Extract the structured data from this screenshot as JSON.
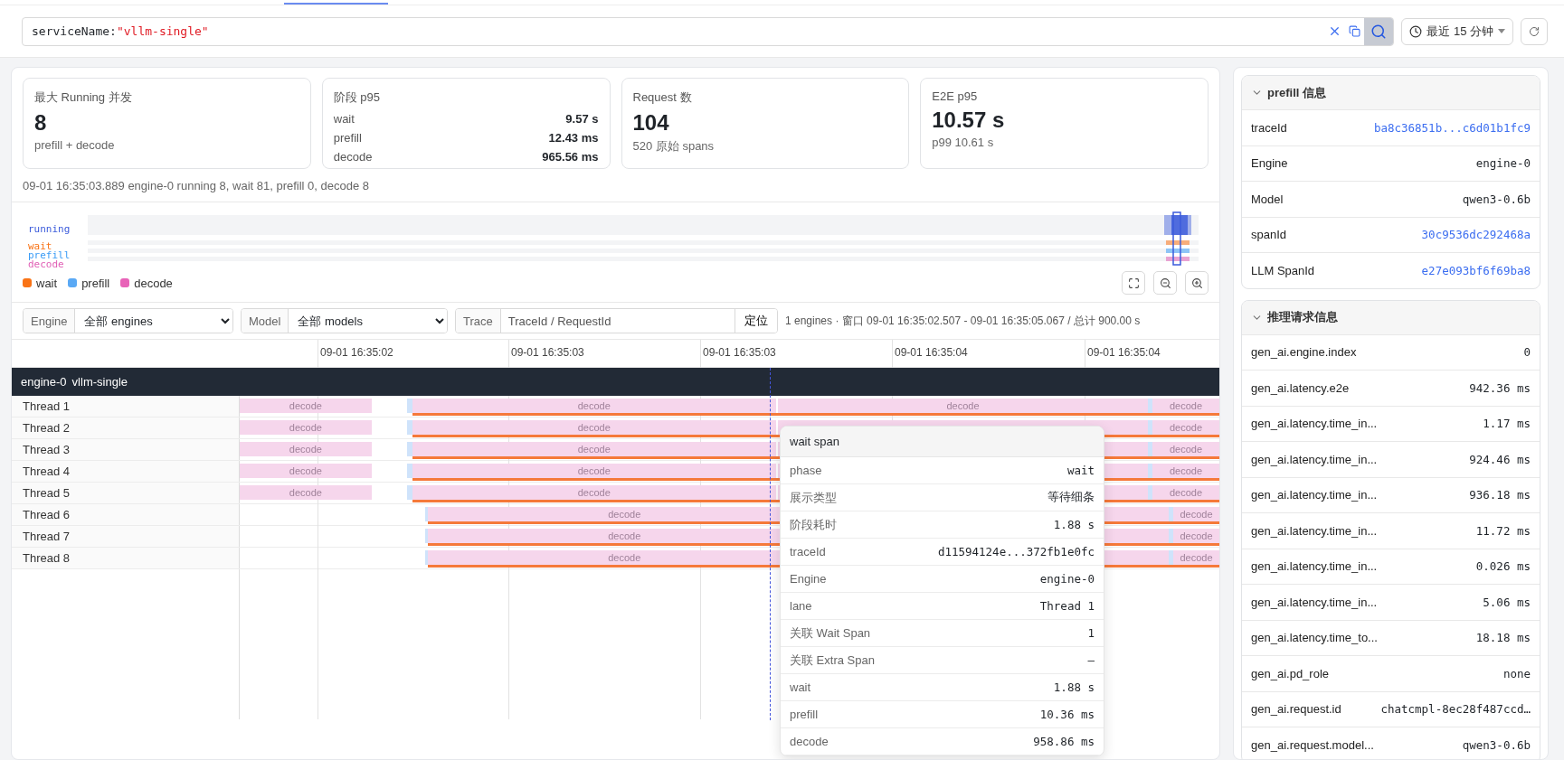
{
  "search": {
    "key": "serviceName:",
    "value": "\"vllm-single\""
  },
  "time_range": {
    "label": "最近 15 分钟"
  },
  "cards": [
    {
      "kind": "stat",
      "title": "最大 Running 并发",
      "value": "8",
      "sub": "prefill + decode"
    },
    {
      "kind": "table",
      "title": "阶段 p95",
      "rows": [
        {
          "label": "wait",
          "value": "9.57 s"
        },
        {
          "label": "prefill",
          "value": "12.43 ms"
        },
        {
          "label": "decode",
          "value": "965.56 ms"
        }
      ]
    },
    {
      "kind": "stat",
      "title": "Request 数",
      "value": "104",
      "sub": "520 原始 spans"
    },
    {
      "kind": "stat",
      "title": "E2E p95",
      "value": "10.57 s",
      "sub": "p99 10.61 s"
    }
  ],
  "status_line": "09-01 16:35:03.889 engine-0 running 8, wait 81, prefill 0, decode 8",
  "minimap": {
    "rows": [
      {
        "label": "running",
        "color": "#3b5bdb"
      },
      {
        "label": "wait",
        "color": "#f97316"
      },
      {
        "label": "prefill",
        "color": "#3b9cf6"
      },
      {
        "label": "decode",
        "color": "#e05fb5"
      }
    ]
  },
  "legend": [
    {
      "label": "wait",
      "color": "#f97316"
    },
    {
      "label": "prefill",
      "color": "#5aa9f5"
    },
    {
      "label": "decode",
      "color": "#e863b8"
    }
  ],
  "filters": {
    "engine": {
      "label": "Engine",
      "value": "全部 engines"
    },
    "model": {
      "label": "Model",
      "value": "全部 models"
    },
    "trace": {
      "label": "Trace",
      "placeholder": "TraceId / RequestId",
      "button": "定位"
    },
    "summary": "1 engines · 窗口 09-01 16:35:02.507 - 09-01 16:35:05.067 / 总计 900.00 s"
  },
  "axis_ticks": [
    "09-01 16:35:02",
    "09-01 16:35:03",
    "09-01 16:35:03",
    "09-01 16:35:04",
    "09-01 16:35:04"
  ],
  "engine_group": {
    "name": "engine-0",
    "service": "vllm-single"
  },
  "threads": [
    {
      "name": "Thread 1",
      "spans": [
        "decode",
        "decode",
        "decode",
        "decode"
      ]
    },
    {
      "name": "Thread 2",
      "spans": [
        "decode",
        "decode",
        "decode"
      ]
    },
    {
      "name": "Thread 3",
      "spans": [
        "decode",
        "decode",
        "decode"
      ]
    },
    {
      "name": "Thread 4",
      "spans": [
        "decode",
        "decode",
        "decode"
      ]
    },
    {
      "name": "Thread 5",
      "spans": [
        "decode",
        "decode",
        "decode"
      ]
    },
    {
      "name": "Thread 6",
      "spans": [
        "decode",
        "decode"
      ]
    },
    {
      "name": "Thread 7",
      "spans": [
        "decode",
        "decode"
      ]
    },
    {
      "name": "Thread 8",
      "spans": [
        "decode",
        "decode"
      ]
    }
  ],
  "tooltip": {
    "title": "wait span",
    "rows": [
      {
        "label": "phase",
        "value": "wait"
      },
      {
        "label": "展示类型",
        "value": "等待细条"
      },
      {
        "label": "阶段耗时",
        "value": "1.88 s"
      },
      {
        "label": "traceId",
        "value": "d11594124e...372fb1e0fc"
      },
      {
        "label": "Engine",
        "value": "engine-0"
      },
      {
        "label": "lane",
        "value": "Thread 1"
      },
      {
        "label": "关联 Wait Span",
        "value": "1"
      },
      {
        "label": "关联 Extra Span",
        "value": "–"
      },
      {
        "label": "wait",
        "value": "1.88 s"
      },
      {
        "label": "prefill",
        "value": "10.36 ms"
      },
      {
        "label": "decode",
        "value": "958.86 ms"
      }
    ]
  },
  "sections": [
    {
      "title": "prefill 信息",
      "expanded": true,
      "rows": [
        {
          "label": "traceId",
          "value": "ba8c36851b...c6d01b1fc9",
          "link": true
        },
        {
          "label": "Engine",
          "value": "engine-0",
          "link": false
        },
        {
          "label": "Model",
          "value": "qwen3-0.6b",
          "link": false
        },
        {
          "label": "spanId",
          "value": "30c9536dc292468a",
          "link": true
        },
        {
          "label": "LLM SpanId",
          "value": "e27e093bf6f69ba8",
          "link": true
        }
      ]
    },
    {
      "title": "推理请求信息",
      "expanded": true,
      "rows": [
        {
          "label": "gen_ai.engine.index",
          "value": "0",
          "link": false
        },
        {
          "label": "gen_ai.latency.e2e",
          "value": "942.36 ms",
          "link": false
        },
        {
          "label": "gen_ai.latency.time_in...",
          "value": "1.17 ms",
          "link": false
        },
        {
          "label": "gen_ai.latency.time_in...",
          "value": "924.46 ms",
          "link": false
        },
        {
          "label": "gen_ai.latency.time_in...",
          "value": "936.18 ms",
          "link": false
        },
        {
          "label": "gen_ai.latency.time_in...",
          "value": "11.72 ms",
          "link": false
        },
        {
          "label": "gen_ai.latency.time_in...",
          "value": "0.026 ms",
          "link": false
        },
        {
          "label": "gen_ai.latency.time_in...",
          "value": "5.06 ms",
          "link": false
        },
        {
          "label": "gen_ai.latency.time_to...",
          "value": "18.18 ms",
          "link": false
        },
        {
          "label": "gen_ai.pd_role",
          "value": "none",
          "link": false
        },
        {
          "label": "gen_ai.request.id",
          "value": "chatcmpl-8ec28f487ccd…",
          "link": false
        },
        {
          "label": "gen_ai.request.model...",
          "value": "qwen3-0.6b",
          "link": false
        }
      ]
    }
  ]
}
